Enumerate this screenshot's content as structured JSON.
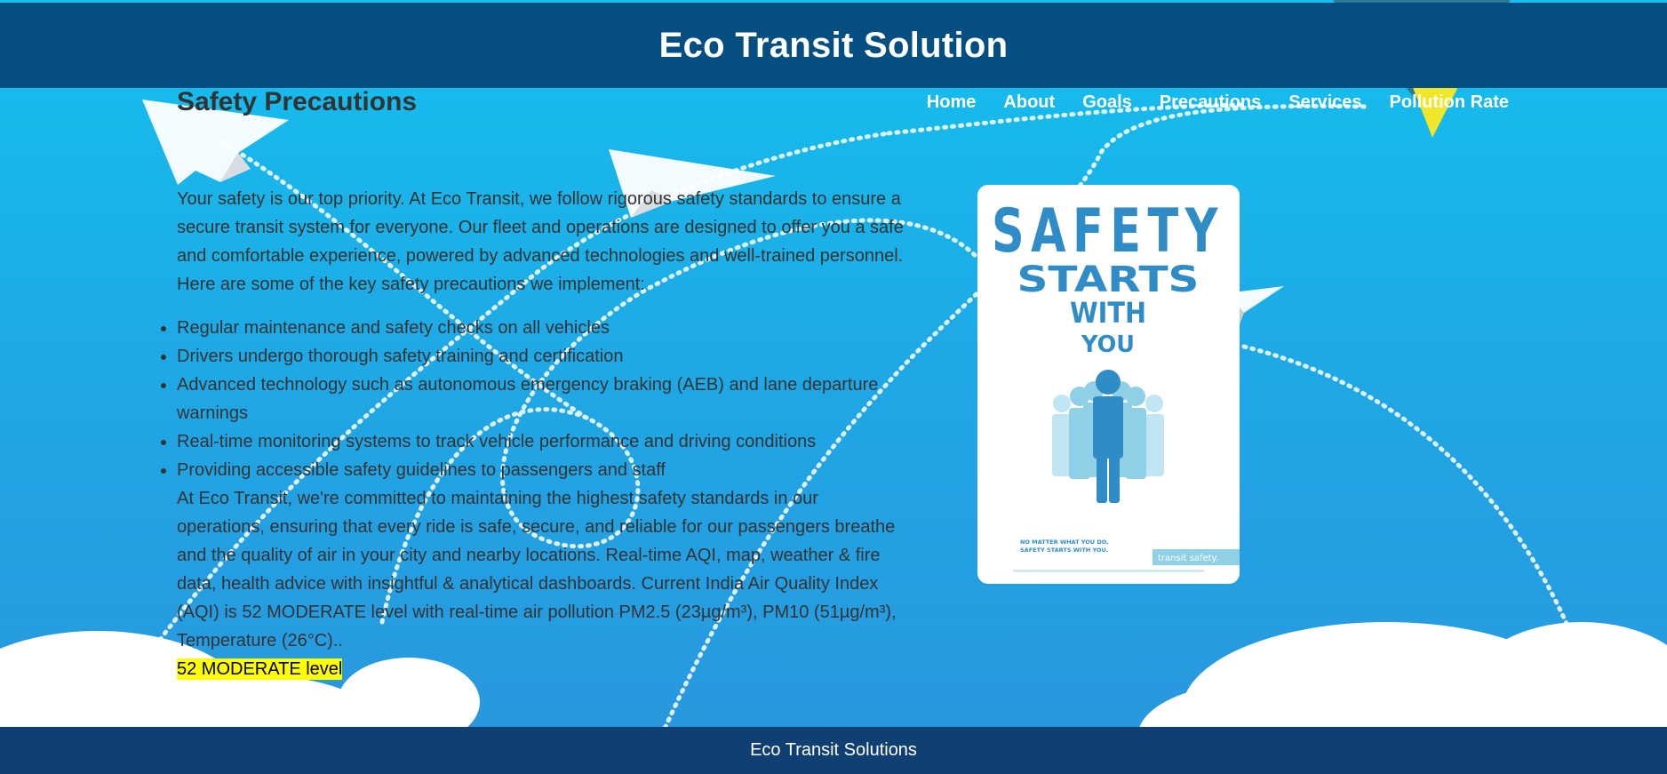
{
  "header": {
    "title": "Eco Transit Solution"
  },
  "page_title": "Safety Precautions",
  "nav": {
    "items": [
      {
        "label": "Home"
      },
      {
        "label": "About"
      },
      {
        "label": "Goals"
      },
      {
        "label": "Precautions"
      },
      {
        "label": "Services"
      },
      {
        "label": "Pollution Rate"
      }
    ]
  },
  "intro": "Your safety is our top priority. At Eco Transit, we follow rigorous safety standards to ensure a secure transit system for everyone. Our fleet and operations are designed to offer you a safe and comfortable experience, powered by advanced technologies and well-trained personnel. Here are some of the key safety precautions we implement:",
  "precautions": [
    "Regular maintenance and safety checks on all vehicles",
    "Drivers undergo thorough safety training and certification",
    "Advanced technology such as autonomous emergency braking (AEB) and lane departure warnings",
    "Real-time monitoring systems to track vehicle performance and driving conditions",
    "Providing accessible safety guidelines to passengers and staff"
  ],
  "closing": "At Eco Transit, we're committed to maintaining the highest safety standards in our operations, ensuring that every ride is safe, secure, and reliable for our passengers breathe and the quality of air in your city and nearby locations. Real-time AQI, map, weather & fire data, health advice with insightful & analytical dashboards. Current India Air Quality Index (AQI) is 52 MODERATE level with real-time air pollution PM2.5 (23µg/m³), PM10 (51µg/m³), Temperature (26°C)..",
  "aqi_highlight": "52 MODERATE level",
  "poster": {
    "line1": "SAFETY",
    "line2": "STARTS",
    "line3": "WITH",
    "line4": "YOU",
    "tagline1": "NO MATTER WHAT YOU DO,",
    "tagline2": "SAFETY STARTS WITH YOU.",
    "badge": "transit safety.",
    "colors": {
      "primary": "#2f8cc6",
      "light": "#8fd0e6"
    }
  },
  "footer": {
    "text": "Eco Transit Solutions"
  },
  "colors": {
    "header_bg": "#044e82",
    "footer_bg": "#0f3f73",
    "sky_top": "#14c0ee",
    "sky_bottom": "#2a95de",
    "highlight": "#ffff00"
  }
}
